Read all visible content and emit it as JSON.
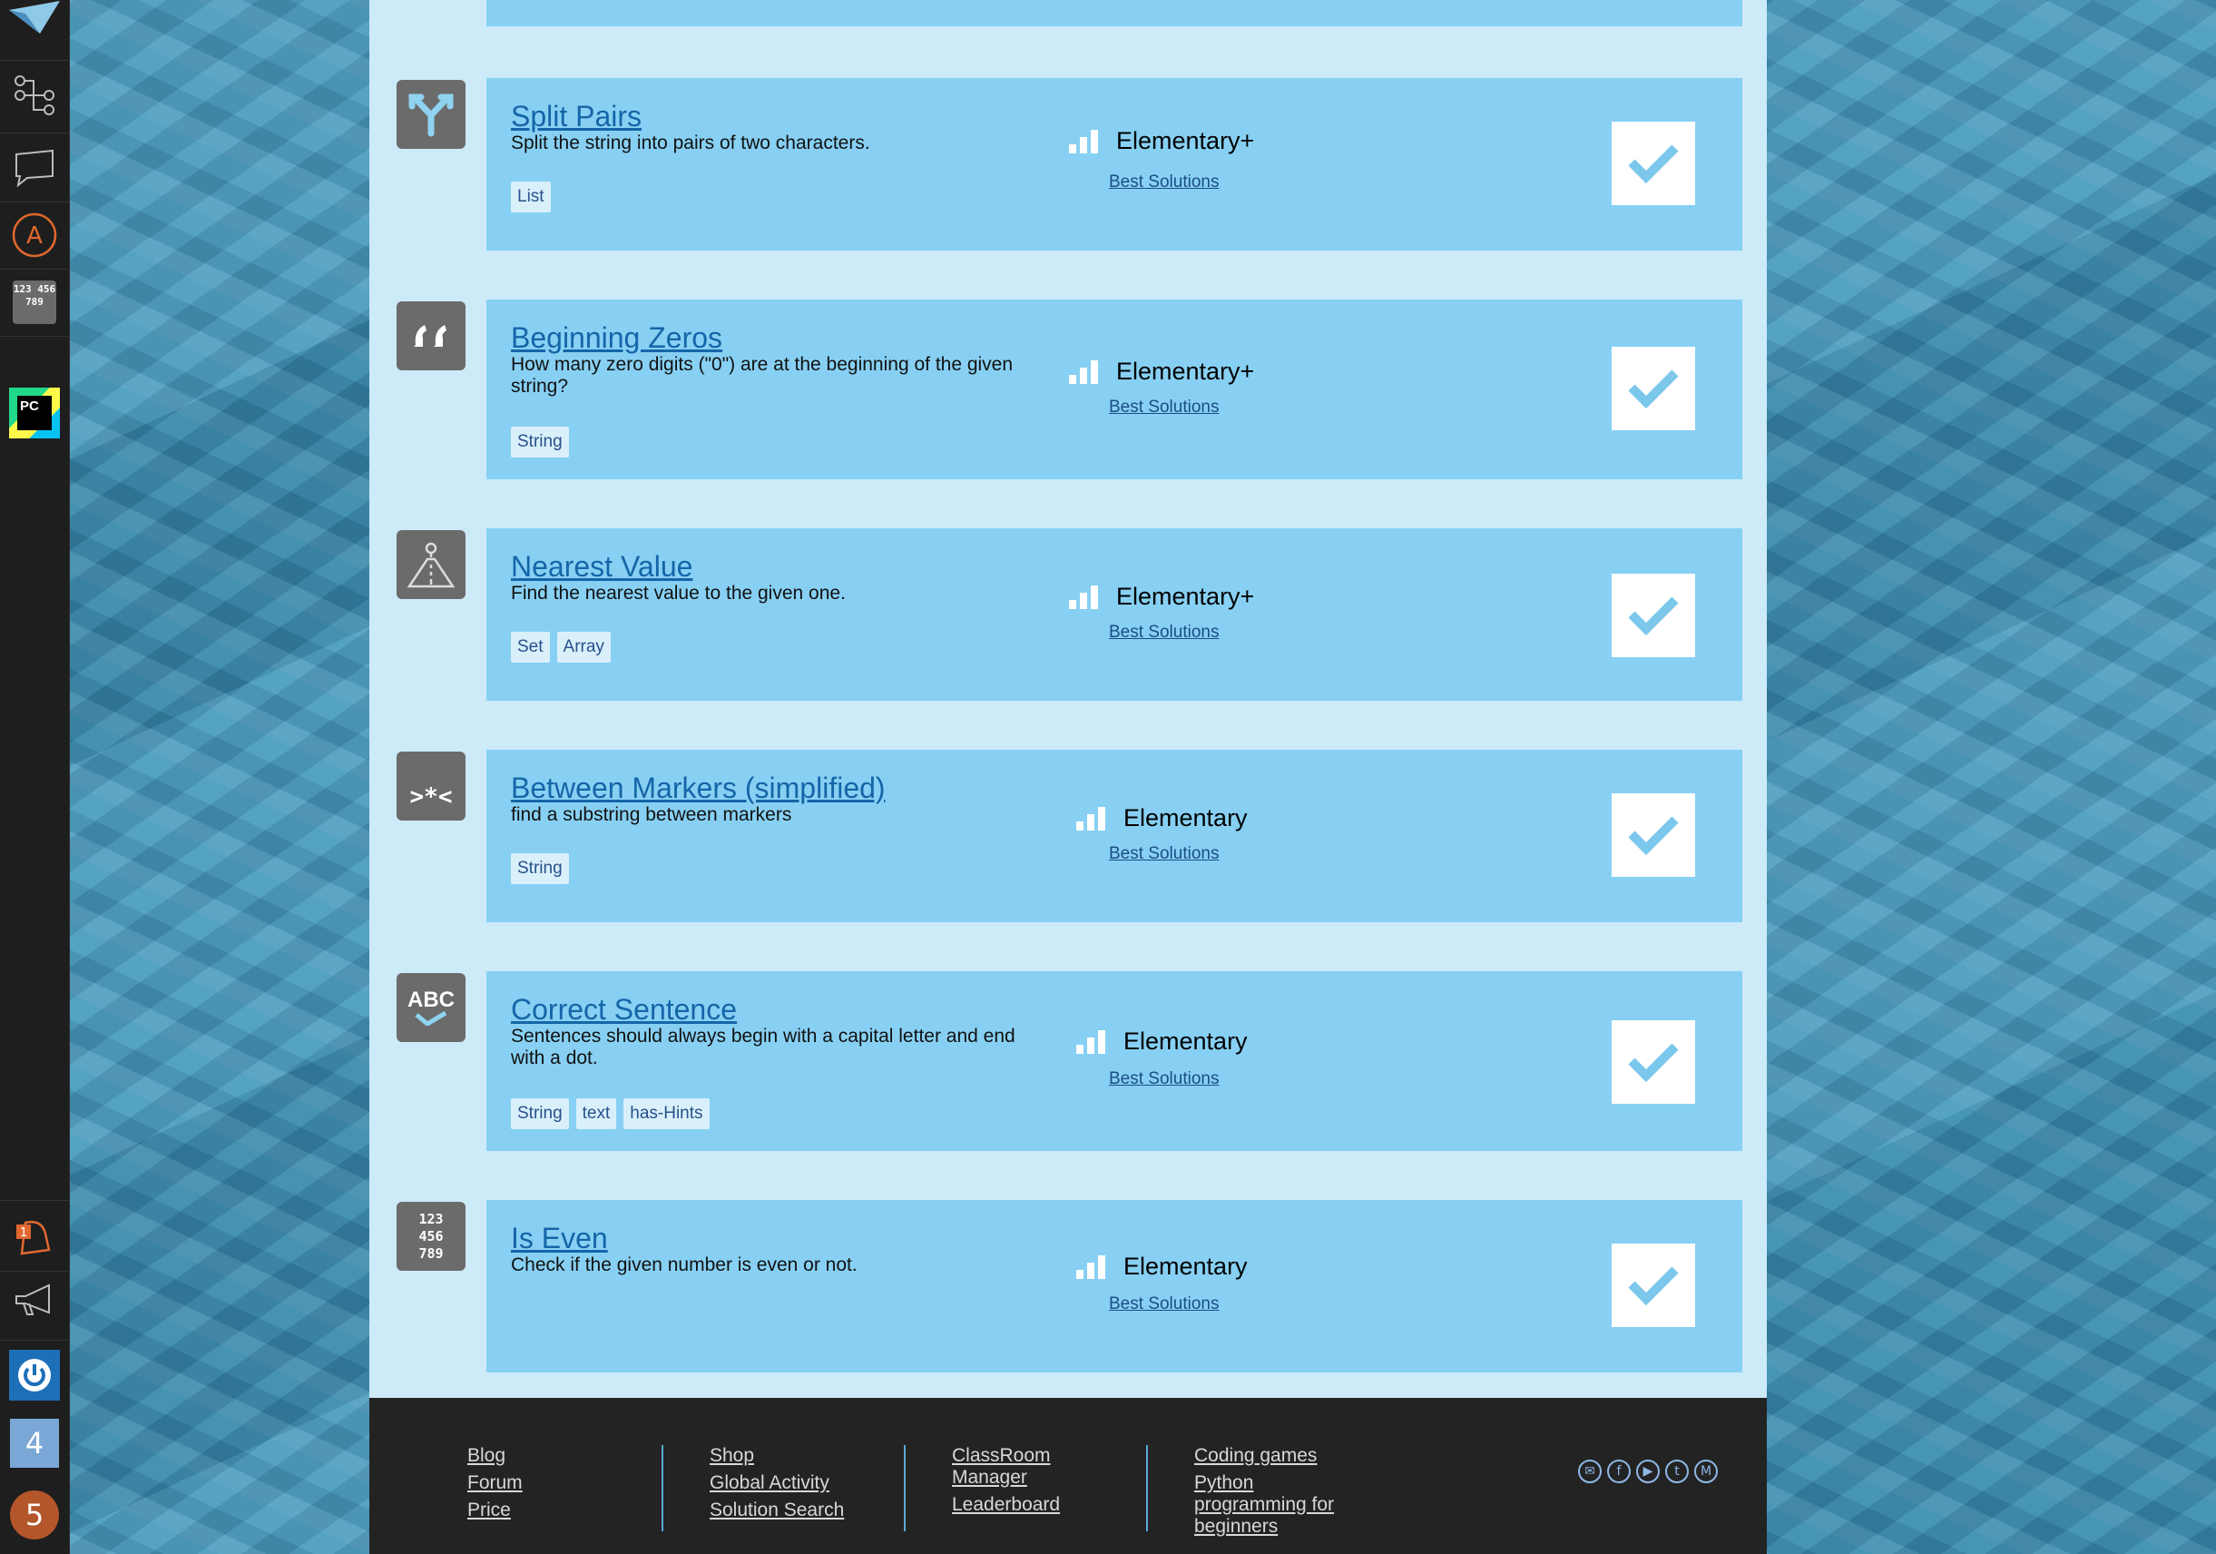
{
  "sidebar": {
    "badge_count": "1",
    "item_4": "4",
    "item_5": "5",
    "pycharm_label": "PC",
    "numbers_label": "123 456 789"
  },
  "missions": [
    {
      "title": "Split Pairs",
      "description": "Split the string into pairs of two characters.",
      "tags": [
        "List"
      ],
      "level": "Elementary+",
      "best": "Best Solutions",
      "icon": "split-arrow-icon"
    },
    {
      "title": "Beginning Zeros",
      "description": "How many zero digits (\"0\") are at the beginning of the given string?",
      "tags": [
        "String"
      ],
      "level": "Elementary+",
      "best": "Best Solutions",
      "icon": "quote-icon"
    },
    {
      "title": "Nearest Value",
      "description": "Find the nearest value to the given one.",
      "tags": [
        "Set",
        "Array"
      ],
      "level": "Elementary+",
      "best": "Best Solutions",
      "icon": "road-pin-icon"
    },
    {
      "title": "Between Markers (simplified)",
      "description": "find a substring between markers",
      "tags": [
        "String"
      ],
      "level": "Elementary",
      "best": "Best Solutions",
      "icon": "markers-icon"
    },
    {
      "title": "Correct Sentence",
      "description": "Sentences should always begin with a capital letter and end with a dot.",
      "tags": [
        "String",
        "text",
        "has-Hints"
      ],
      "level": "Elementary",
      "best": "Best Solutions",
      "icon": "abc-check-icon"
    },
    {
      "title": "Is Even",
      "description": "Check if the given number is even or not.",
      "tags": [],
      "level": "Elementary",
      "best": "Best Solutions",
      "icon": "numbers-grid-icon"
    }
  ],
  "icon_text": {
    "markers": ">*<",
    "abc": "ABC",
    "numbers": "123 456 789"
  },
  "footer": {
    "col1": [
      "Blog",
      "Forum",
      "Price"
    ],
    "col2": [
      "Shop",
      "Global Activity",
      "Solution Search"
    ],
    "col3": [
      "ClassRoom Manager",
      "Leaderboard"
    ],
    "col4": [
      "Coding games",
      "Python programming for beginners"
    ],
    "social": [
      "mail-icon",
      "facebook-icon",
      "youtube-icon",
      "twitter-icon",
      "medium-icon"
    ]
  },
  "colors": {
    "card": "#87d0f3",
    "panel": "#cdeaf9",
    "link": "#1565a8",
    "sidebar": "#1e1e1e",
    "footer": "#232323"
  }
}
